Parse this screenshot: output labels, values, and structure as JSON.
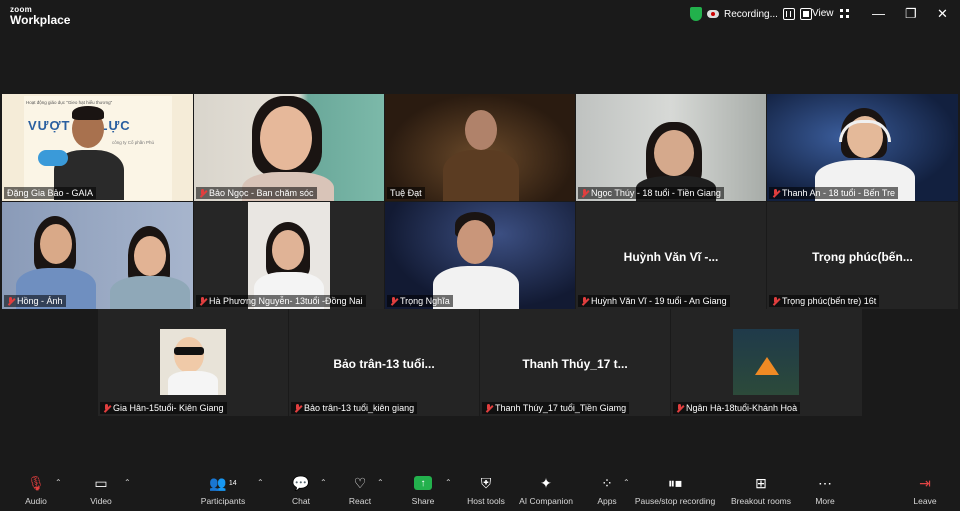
{
  "app": {
    "brand_top": "zoom",
    "brand_bottom": "Workplace"
  },
  "topbar": {
    "recording_label": "Recording...",
    "view_label": "View"
  },
  "tiles": [
    {
      "name": "Đặng Gia Bảo - GAIA",
      "muted": false,
      "active": true,
      "kind": "slide",
      "slide_title": "VƯỢT   ÁP LỰC",
      "slide_line1": "Hoạt động giáo dục \"Gieo hạt hiểu thương\"",
      "slide_line2": "công ty Cổ phần Phú"
    },
    {
      "name": "Bảo Ngọc - Ban chăm sóc",
      "muted": true
    },
    {
      "name": "Tuệ Đạt",
      "muted": false
    },
    {
      "name": "Ngọc Thúy - 18 tuổi - Tiền Giang",
      "muted": true
    },
    {
      "name": "Thanh An - 18 tuổi - Bến Tre",
      "muted": true
    },
    {
      "name": "Hồng - Ánh",
      "muted": true
    },
    {
      "name": "Hà Phương Nguyễn- 13tuổi -Đồng Nai",
      "muted": true
    },
    {
      "name": "Trọng Nghĩa",
      "muted": true
    },
    {
      "name": "Huỳnh Văn Vĩ - 19 tuổi - An Giang",
      "muted": true,
      "display_name": "Huỳnh Văn Vĩ -..."
    },
    {
      "name": "Trọng phúc(bến tre) 16t",
      "muted": true,
      "display_name": "Trọng  phúc(bến..."
    },
    {
      "name": "Gia Hân-15tuổi- Kiên Giang",
      "muted": true
    },
    {
      "name": "Bảo trân-13 tuổi_kiên giang",
      "muted": true,
      "display_name": "Bảo trân-13 tuổi..."
    },
    {
      "name": "Thanh Thúy_17 tuổi_Tiền Giamg",
      "muted": true,
      "display_name": "Thanh Thúy_17 t..."
    },
    {
      "name": "Ngân Hà-18tuổi-Khánh Hoà",
      "muted": true
    }
  ],
  "toolbar": {
    "audio": "Audio",
    "video": "Video",
    "participants": "Participants",
    "participants_count": "14",
    "chat": "Chat",
    "react": "React",
    "share": "Share",
    "host_tools": "Host tools",
    "ai_companion": "AI Companion",
    "apps": "Apps",
    "pause_stop": "Pause/stop recording",
    "breakout": "Breakout rooms",
    "more": "More",
    "leave": "Leave"
  },
  "colors": {
    "accent_green": "#23d959",
    "muted_red": "#e03e3e",
    "share_green": "#23b14d",
    "leave_red": "#e04444"
  }
}
